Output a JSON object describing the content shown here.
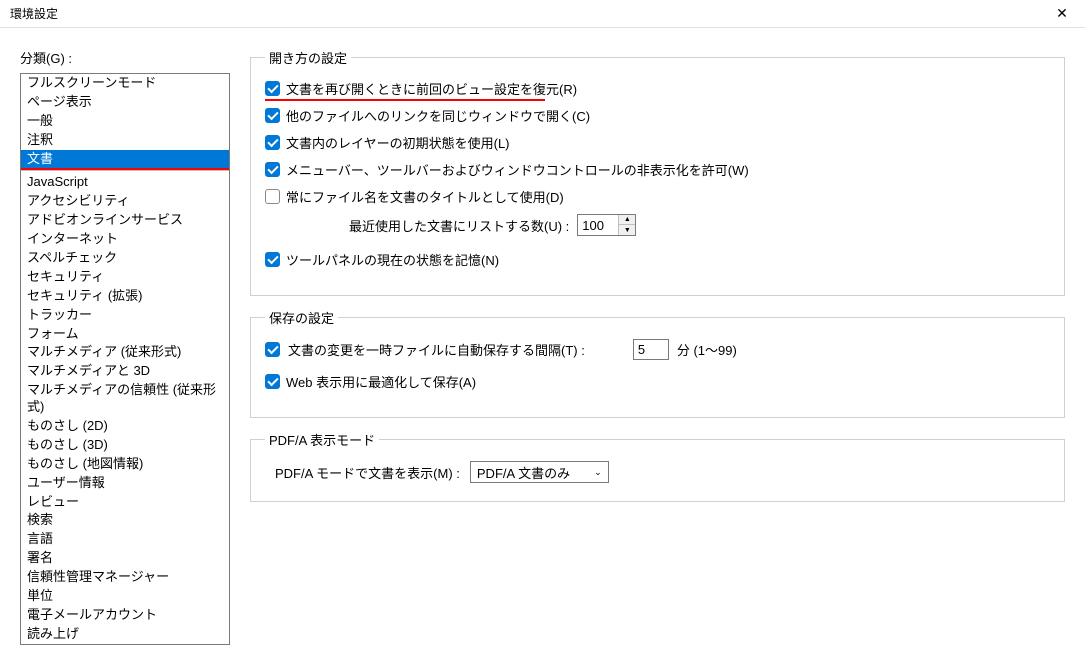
{
  "window": {
    "title": "環境設定"
  },
  "sidebar": {
    "label": "分類(G) :",
    "items_top": [
      "フルスクリーンモード",
      "ページ表示",
      "一般",
      "注釈",
      "文書"
    ],
    "items_bottom": [
      "JavaScript",
      "アクセシビリティ",
      "アドビオンラインサービス",
      "インターネット",
      "スペルチェック",
      "セキュリティ",
      "セキュリティ (拡張)",
      "トラッカー",
      "フォーム",
      "マルチメディア (従来形式)",
      "マルチメディアと 3D",
      "マルチメディアの信頼性 (従来形式)",
      "ものさし (2D)",
      "ものさし (3D)",
      "ものさし (地図情報)",
      "ユーザー情報",
      "レビュー",
      "検索",
      "言語",
      "署名",
      "信頼性管理マネージャー",
      "単位",
      "電子メールアカウント",
      "読み上げ"
    ],
    "selected_index": 4
  },
  "open_settings": {
    "legend": "開き方の設定",
    "cb1": "文書を再び開くときに前回のビュー設定を復元(R)",
    "cb2": "他のファイルへのリンクを同じウィンドウで開く(C)",
    "cb3": "文書内のレイヤーの初期状態を使用(L)",
    "cb4": "メニューバー、ツールバーおよびウィンドウコントロールの非表示化を許可(W)",
    "cb5": "常にファイル名を文書のタイトルとして使用(D)",
    "recent_label": "最近使用した文書にリストする数(U) :",
    "recent_value": "100",
    "cb6": "ツールパネルの現在の状態を記憶(N)"
  },
  "save_settings": {
    "legend": "保存の設定",
    "cb1": "文書の変更を一時ファイルに自動保存する間隔(T) :",
    "interval_value": "5",
    "interval_unit": "分 (1～99)",
    "cb2": "Web 表示用に最適化して保存(A)"
  },
  "pdfa_settings": {
    "legend": "PDF/A 表示モード",
    "label": "PDF/A モードで文書を表示(M) :",
    "value": "PDF/A 文書のみ"
  }
}
